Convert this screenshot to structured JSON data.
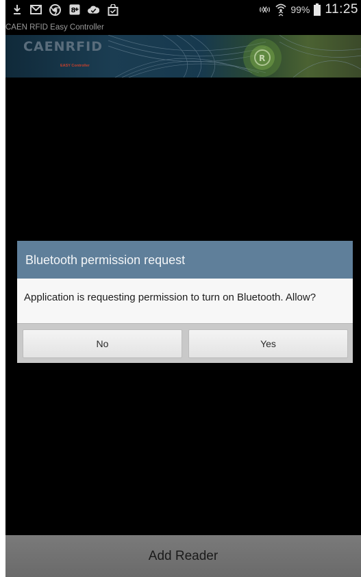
{
  "status_bar": {
    "left_icons": [
      "download-icon",
      "gmail-icon",
      "chrome-icon",
      "google-plus-icon",
      "cloud-check-icon",
      "shopping-bag-check-icon"
    ],
    "right_icons": [
      "nfc-mute-icon",
      "wifi-icon",
      "battery-icon"
    ],
    "battery_percent": "99%",
    "time": "11:25"
  },
  "app": {
    "title": "CAEN RFID Easy Controller",
    "banner_logo": "CAENRFID",
    "banner_sub": "EASY Controller"
  },
  "dialog": {
    "title": "Bluetooth permission request",
    "message": "Application is requesting permission to turn on Bluetooth. Allow?",
    "no_label": "No",
    "yes_label": "Yes"
  },
  "bottom_button": {
    "label": "Add Reader"
  },
  "colors": {
    "dialog_header": "#5f7f9a",
    "dialog_body": "#f7f7f7",
    "screen_background": "#000000",
    "bottom_button": "#737373"
  }
}
